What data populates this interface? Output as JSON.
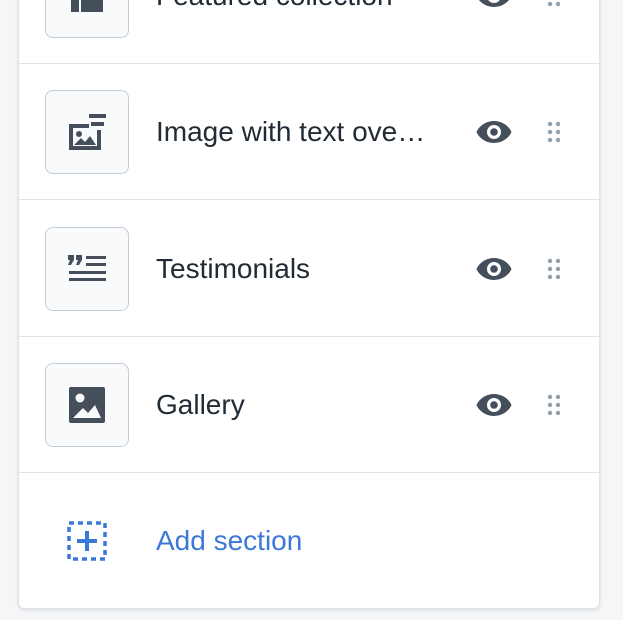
{
  "sections": [
    {
      "label": "Featured collection",
      "icon": "collection-icon"
    },
    {
      "label": "Image with text ove…",
      "icon": "image-with-text-icon"
    },
    {
      "label": "Testimonials",
      "icon": "quote-icon"
    },
    {
      "label": "Gallery",
      "icon": "image-icon"
    }
  ],
  "add_section": {
    "label": "Add section",
    "icon": "add-section-icon"
  },
  "colors": {
    "text": "#212b36",
    "icon": "#454f5b",
    "muted": "#919eab",
    "link": "#3c78d8",
    "border": "#dfe3e8"
  }
}
